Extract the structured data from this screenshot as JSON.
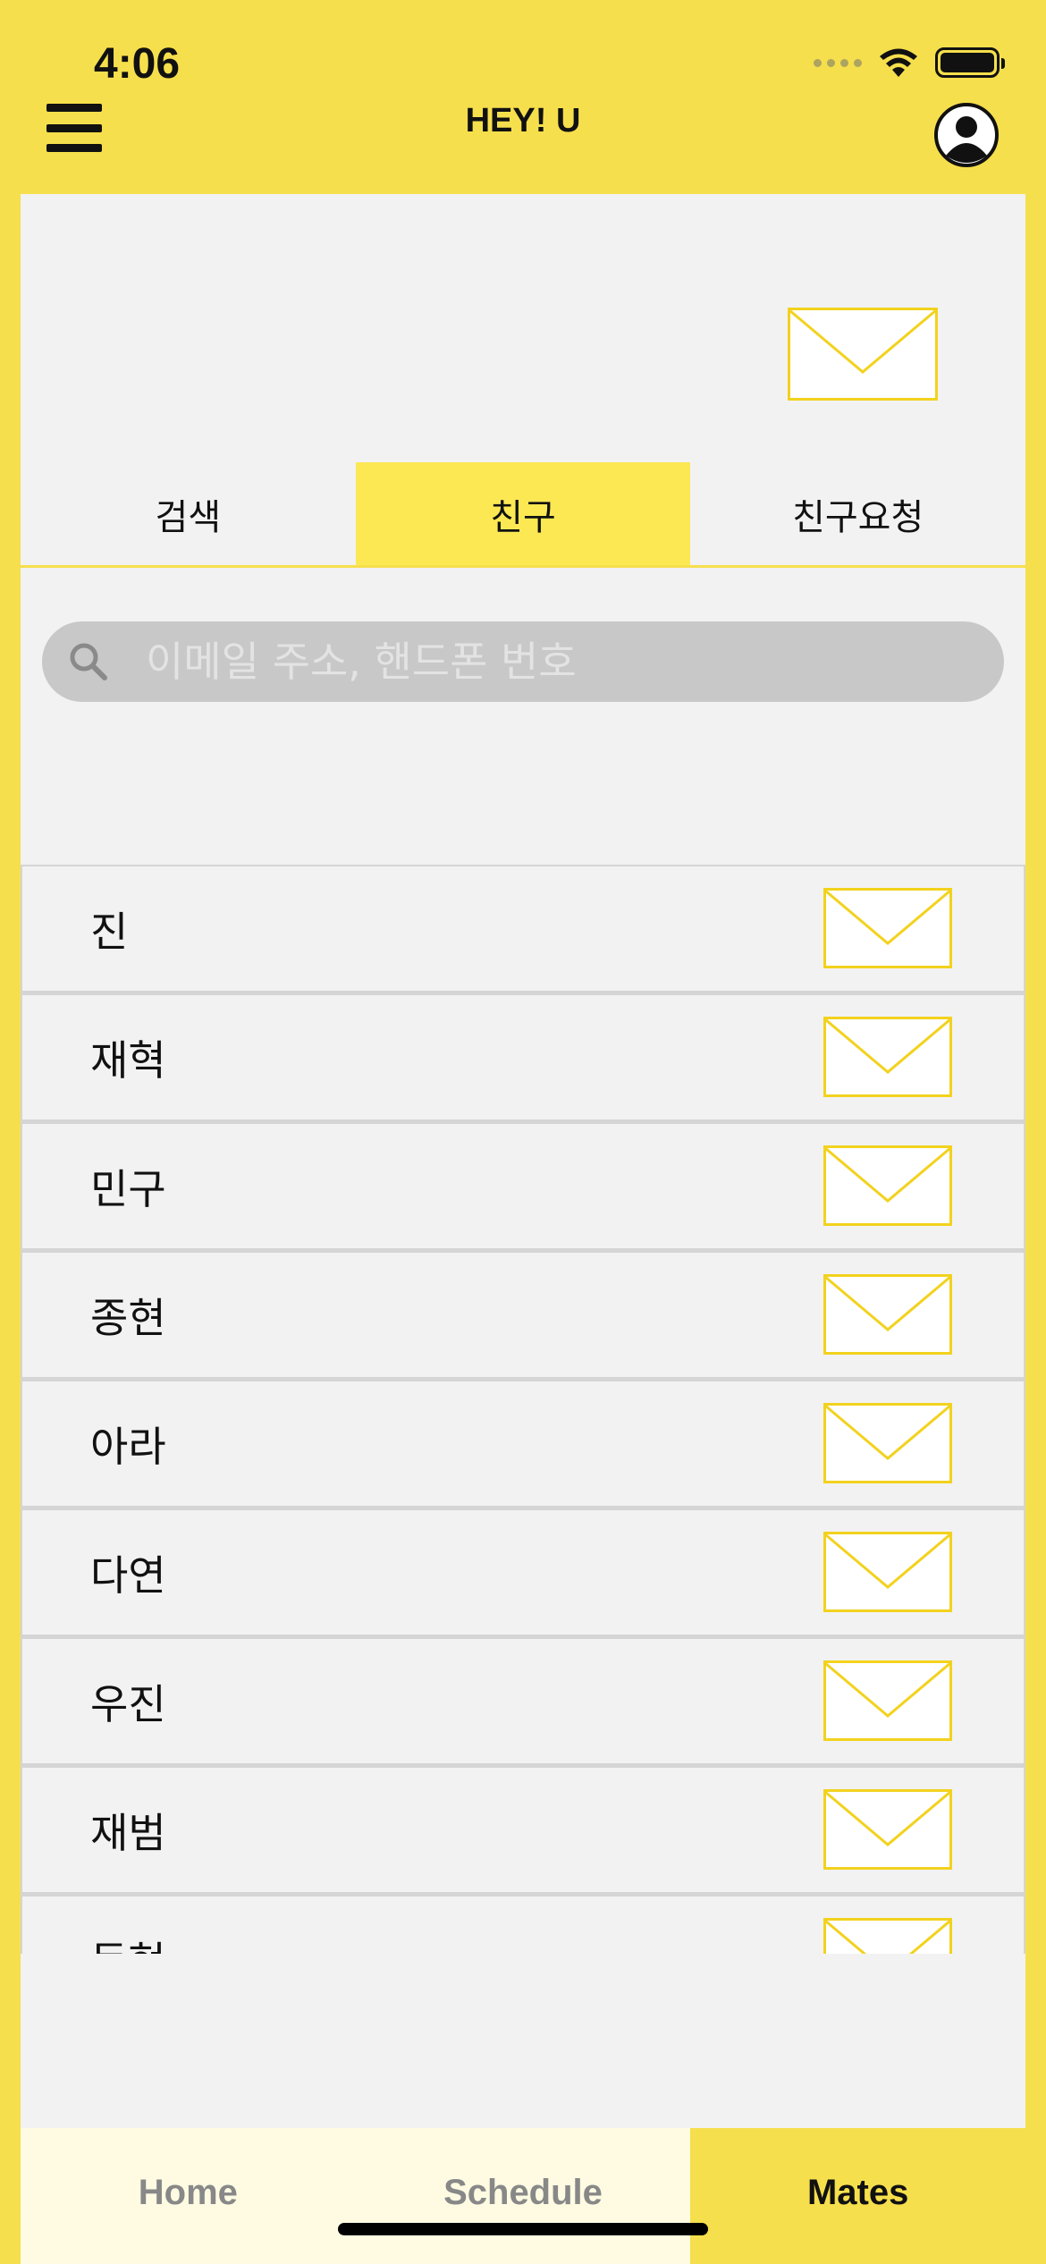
{
  "status": {
    "time": "4:06"
  },
  "nav": {
    "title": "HEY! U"
  },
  "tabs": [
    {
      "label": "검색",
      "active": false
    },
    {
      "label": "친구",
      "active": true
    },
    {
      "label": "친구요청",
      "active": false
    }
  ],
  "search": {
    "placeholder": "이메일 주소, 핸드폰 번호"
  },
  "friends": [
    {
      "name": "진"
    },
    {
      "name": "재혁"
    },
    {
      "name": "민구"
    },
    {
      "name": "종현"
    },
    {
      "name": "아라"
    },
    {
      "name": "다연"
    },
    {
      "name": "우진"
    },
    {
      "name": "재범"
    },
    {
      "name": "동현"
    }
  ],
  "bottom_tabs": [
    {
      "label": "Home",
      "active": false
    },
    {
      "label": "Schedule",
      "active": false
    },
    {
      "label": "Mates",
      "active": true
    }
  ],
  "colors": {
    "accent": "#F6DF4C",
    "tab_active": "#FCE853",
    "envelope": "#F2D21E"
  },
  "icons": {
    "menu": "hamburger-icon",
    "profile": "person-circle-icon",
    "mail": "envelope-icon",
    "search": "search-icon"
  }
}
